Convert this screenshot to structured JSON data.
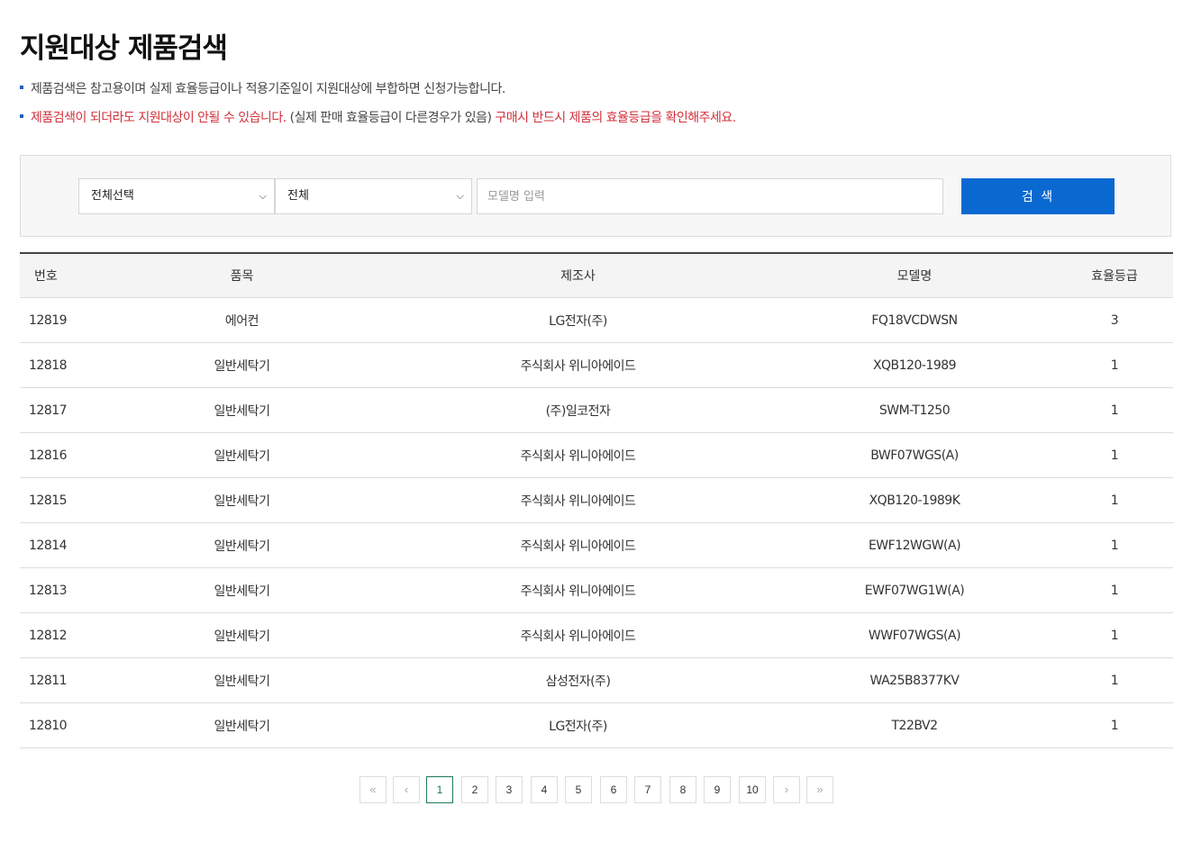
{
  "header": {
    "title": "지원대상 제품검색"
  },
  "notices": {
    "line1": "제품검색은 참고용이며 실제 효율등급이나 적용기준일이 지원대상에 부합하면 신청가능합니다.",
    "line2_red1": "제품검색이 되더라도 지원대상이 안될 수 있습니다.",
    "line2_plain": " (실제 판매 효율등급이 다른경우가 있음) ",
    "line2_red2": "구매시 반드시 제품의 효율등급을 확인해주세요.",
    "accent_color": "#d1303a"
  },
  "search": {
    "category_selected": "전체선택",
    "type_selected": "전체",
    "model_placeholder": "모델명 입력",
    "button_label": "검 색",
    "button_color": "#0a69d1"
  },
  "table": {
    "headers": {
      "no": "번호",
      "item": "품목",
      "maker": "제조사",
      "model": "모델명",
      "grade": "효율등급"
    },
    "rows": [
      {
        "no": "12819",
        "item": "에어컨",
        "maker": "LG전자(주)",
        "model": "FQ18VCDWSN",
        "grade": "3"
      },
      {
        "no": "12818",
        "item": "일반세탁기",
        "maker": "주식회사 위니아에이드",
        "model": "XQB120-1989",
        "grade": "1"
      },
      {
        "no": "12817",
        "item": "일반세탁기",
        "maker": "(주)일코전자",
        "model": "SWM-T1250",
        "grade": "1"
      },
      {
        "no": "12816",
        "item": "일반세탁기",
        "maker": "주식회사 위니아에이드",
        "model": "BWF07WGS(A)",
        "grade": "1"
      },
      {
        "no": "12815",
        "item": "일반세탁기",
        "maker": "주식회사 위니아에이드",
        "model": "XQB120-1989K",
        "grade": "1"
      },
      {
        "no": "12814",
        "item": "일반세탁기",
        "maker": "주식회사 위니아에이드",
        "model": "EWF12WGW(A)",
        "grade": "1"
      },
      {
        "no": "12813",
        "item": "일반세탁기",
        "maker": "주식회사 위니아에이드",
        "model": "EWF07WG1W(A)",
        "grade": "1"
      },
      {
        "no": "12812",
        "item": "일반세탁기",
        "maker": "주식회사 위니아에이드",
        "model": "WWF07WGS(A)",
        "grade": "1"
      },
      {
        "no": "12811",
        "item": "일반세탁기",
        "maker": "삼성전자(주)",
        "model": "WA25B8377KV",
        "grade": "1"
      },
      {
        "no": "12810",
        "item": "일반세탁기",
        "maker": "LG전자(주)",
        "model": "T22BV2",
        "grade": "1"
      }
    ]
  },
  "pagination": {
    "first": "«",
    "prev": "‹",
    "pages": [
      "1",
      "2",
      "3",
      "4",
      "5",
      "6",
      "7",
      "8",
      "9",
      "10"
    ],
    "current": "1",
    "next": "›",
    "last": "»",
    "active_color": "#1d7a55"
  }
}
